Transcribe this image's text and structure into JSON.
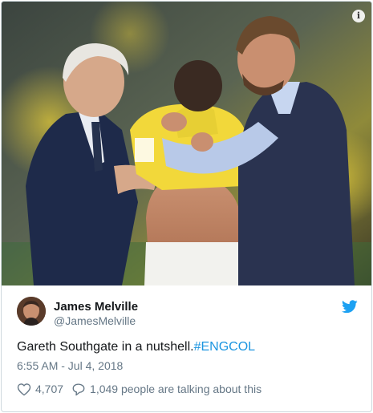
{
  "media": {
    "info_glyph": "i",
    "info_icon": "info-icon",
    "scene": "photo"
  },
  "author": {
    "name": "James Melville",
    "handle": "@JamesMelville",
    "avatar": "avatar-photo"
  },
  "brand": {
    "icon": "twitter-bird-icon",
    "color": "#1da1f2"
  },
  "tweet": {
    "text": "Gareth Southgate in a nutshell.",
    "hashtag": "#ENGCOL",
    "hashtag_color": "#1b95e0",
    "timestamp": "6:55 AM - Jul 4, 2018"
  },
  "actions": {
    "like_icon": "heart-icon",
    "like_count": "4,707",
    "reply_icon": "speech-bubble-icon",
    "talking_text": "1,049 people are talking about this"
  }
}
